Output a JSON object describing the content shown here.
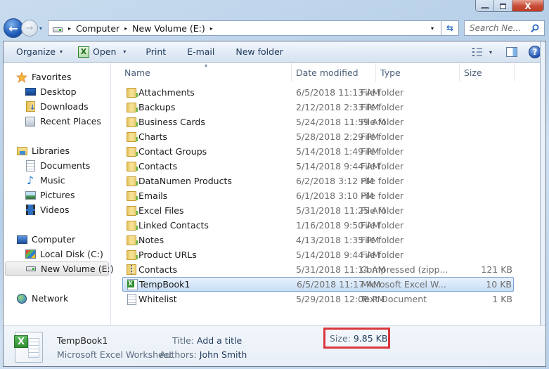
{
  "window": {
    "controls": {
      "minimize": "minimize",
      "maximize": "maximize",
      "close": "X"
    }
  },
  "nav": {
    "back_glyph": "←",
    "forward_glyph": "→",
    "recent_glyph": "▾",
    "breadcrumb": [
      "Computer",
      "New Volume (E:)"
    ],
    "separator": "▸",
    "dropdown_glyph": "▾",
    "refresh_glyph": "⇆",
    "search_placeholder": "Search Ne..."
  },
  "toolbar": {
    "organize": "Organize",
    "open": "Open",
    "print": "Print",
    "email": "E-mail",
    "new_folder": "New folder",
    "caret": "▾",
    "excel_glyph": "X",
    "help_glyph": "?"
  },
  "sidebar": {
    "favorites": {
      "label": "Favorites",
      "items": [
        "Desktop",
        "Downloads",
        "Recent Places"
      ]
    },
    "libraries": {
      "label": "Libraries",
      "items": [
        "Documents",
        "Music",
        "Pictures",
        "Videos"
      ]
    },
    "computer": {
      "label": "Computer",
      "items": [
        "Local Disk (C:)",
        "New Volume (E:)"
      ],
      "selected": "New Volume (E:)"
    },
    "network": {
      "label": "Network"
    }
  },
  "columns": {
    "name": "Name",
    "date": "Date modified",
    "type": "Type",
    "size": "Size",
    "sort_glyph": "▴"
  },
  "files": [
    {
      "name": "Attachments",
      "date": "6/5/2018 11:13 AM",
      "type": "File folder",
      "size": "",
      "icon": "folder"
    },
    {
      "name": "Backups",
      "date": "2/12/2018 2:33 PM",
      "type": "File folder",
      "size": "",
      "icon": "folder"
    },
    {
      "name": "Business Cards",
      "date": "5/24/2018 11:59 AM",
      "type": "File folder",
      "size": "",
      "icon": "folder"
    },
    {
      "name": "Charts",
      "date": "5/28/2018 2:29 PM",
      "type": "File folder",
      "size": "",
      "icon": "folder"
    },
    {
      "name": "Contact Groups",
      "date": "5/14/2018 1:49 PM",
      "type": "File folder",
      "size": "",
      "icon": "folder"
    },
    {
      "name": "Contacts",
      "date": "5/14/2018 9:44 AM",
      "type": "File folder",
      "size": "",
      "icon": "folder"
    },
    {
      "name": "DataNumen Products",
      "date": "6/2/2018 3:12 PM",
      "type": "File folder",
      "size": "",
      "icon": "folder"
    },
    {
      "name": "Emails",
      "date": "6/1/2018 3:10 PM",
      "type": "File folder",
      "size": "",
      "icon": "folder"
    },
    {
      "name": "Excel Files",
      "date": "5/31/2018 11:25 AM",
      "type": "File folder",
      "size": "",
      "icon": "folder"
    },
    {
      "name": "Linked Contacts",
      "date": "1/16/2018 9:50 AM",
      "type": "File folder",
      "size": "",
      "icon": "folder"
    },
    {
      "name": "Notes",
      "date": "4/13/2018 1:35 PM",
      "type": "File folder",
      "size": "",
      "icon": "folder"
    },
    {
      "name": "Product URLs",
      "date": "5/14/2018 9:44 AM",
      "type": "File folder",
      "size": "",
      "icon": "folder"
    },
    {
      "name": "Contacts",
      "date": "5/31/2018 11:14 AM",
      "type": "Compressed (zipp...",
      "size": "121 KB",
      "icon": "zip"
    },
    {
      "name": "TempBook1",
      "date": "6/5/2018 11:17 AM",
      "type": "Microsoft Excel W...",
      "size": "10 KB",
      "icon": "excel",
      "selected": true
    },
    {
      "name": "Whitelist",
      "date": "5/29/2018 12:06 PM",
      "type": "Text Document",
      "size": "1 KB",
      "icon": "text"
    }
  ],
  "details": {
    "name": "TempBook1",
    "type": "Microsoft Excel Worksheet",
    "title_label": "Title:",
    "title_value": "Add a title",
    "authors_label": "Authors:",
    "authors_value": "John Smith",
    "size_label": "Size:",
    "size_value": "9.85 KB",
    "highlight_color": "#d9363e"
  }
}
